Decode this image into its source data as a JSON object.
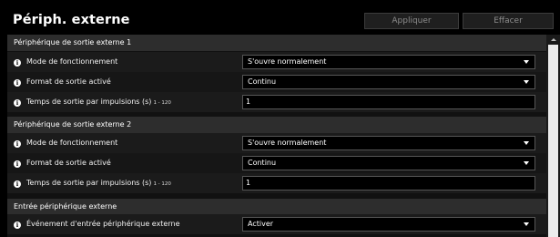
{
  "header": {
    "title": "Périph. externe",
    "apply_label": "Appliquer",
    "clear_label": "Effacer"
  },
  "sections": [
    {
      "title": "Périphérique de sortie externe 1",
      "rows": [
        {
          "label": "Mode de fonctionnement",
          "value": "S'ouvre normalement",
          "type": "select"
        },
        {
          "label": "Format de sortie activé",
          "value": "Continu",
          "type": "select"
        },
        {
          "label": "Temps de sortie par impulsions (s)",
          "range": "1 - 120",
          "value": "1",
          "type": "input"
        }
      ]
    },
    {
      "title": "Périphérique de sortie externe 2",
      "rows": [
        {
          "label": "Mode de fonctionnement",
          "value": "S'ouvre normalement",
          "type": "select"
        },
        {
          "label": "Format de sortie activé",
          "value": "Continu",
          "type": "select"
        },
        {
          "label": "Temps de sortie par impulsions (s)",
          "range": "1 - 120",
          "value": "1",
          "type": "input"
        }
      ]
    },
    {
      "title": "Entrée périphérique externe",
      "rows": [
        {
          "label": "Événement d'entrée périphérique externe",
          "value": "Activer",
          "type": "select"
        }
      ]
    }
  ],
  "icons": {
    "info": "i"
  },
  "colors": {
    "background": "#000000",
    "section_header": "#2d2d2d",
    "row": "#1b1b1b",
    "field_border": "#565656",
    "button_text": "#8d8d8d"
  }
}
